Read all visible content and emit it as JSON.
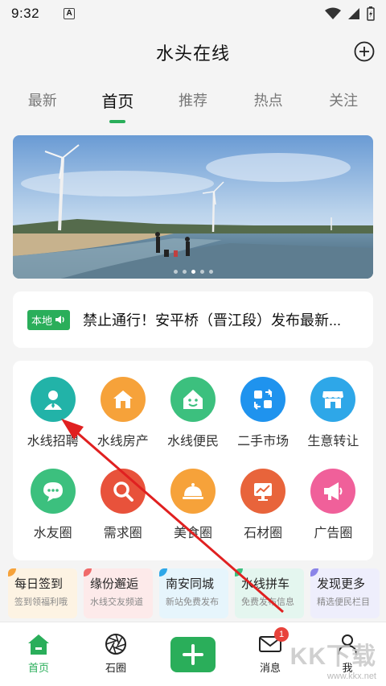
{
  "status": {
    "time": "9:32",
    "notification_badge": "A"
  },
  "app": {
    "title": "水头在线"
  },
  "tabs": [
    {
      "label": "最新"
    },
    {
      "label": "首页"
    },
    {
      "label": "推荐"
    },
    {
      "label": "热点"
    },
    {
      "label": "关注"
    }
  ],
  "active_tab": "首页",
  "banner": {
    "slides": 5,
    "active_slide": 3
  },
  "notice": {
    "badge": "本地",
    "text": "禁止通行！安平桥（晋江段）发布最新..."
  },
  "services": [
    {
      "label": "水线招聘",
      "icon": "person-icon",
      "color": "#22b3a8"
    },
    {
      "label": "水线房产",
      "icon": "house-icon",
      "color": "#f6a23a"
    },
    {
      "label": "水线便民",
      "icon": "smile-house-icon",
      "color": "#3cc07e"
    },
    {
      "label": "二手市场",
      "icon": "exchange-icon",
      "color": "#1f93ee"
    },
    {
      "label": "生意转让",
      "icon": "shop-icon",
      "color": "#2ea7e8"
    },
    {
      "label": "水友圈",
      "icon": "chat-icon",
      "color": "#3cc07e"
    },
    {
      "label": "需求圈",
      "icon": "magnifier-icon",
      "color": "#e8523b"
    },
    {
      "label": "美食圈",
      "icon": "food-cover-icon",
      "color": "#f6a23a"
    },
    {
      "label": "石材圈",
      "icon": "chart-icon",
      "color": "#e8643b"
    },
    {
      "label": "广告圈",
      "icon": "megaphone-icon",
      "color": "#f0609a"
    }
  ],
  "shortcuts": [
    {
      "title": "每日签到",
      "sub": "签到领福利哦",
      "bg": "#fdf3e3",
      "accent": "#f6a23a"
    },
    {
      "title": "缘份邂逅",
      "sub": "水线交友频道",
      "bg": "#fdeaea",
      "accent": "#f06a6a"
    },
    {
      "title": "南安同城",
      "sub": "新站免费发布",
      "bg": "#e6f5fc",
      "accent": "#2ea7e8"
    },
    {
      "title": "水线拼车",
      "sub": "免费发布信息",
      "bg": "#e4f6ef",
      "accent": "#3cc07e"
    },
    {
      "title": "发现更多",
      "sub": "精选便民栏目",
      "bg": "#eeeefc",
      "accent": "#8a84e8"
    }
  ],
  "bottom_nav": [
    {
      "label": "首页"
    },
    {
      "label": "石圈"
    },
    {
      "label": ""
    },
    {
      "label": "消息",
      "badge": "1"
    },
    {
      "label": "我"
    }
  ],
  "watermark": {
    "brand": "KK下载",
    "url": "www.kkx.net"
  },
  "colors": {
    "primary": "#2aae5a",
    "arrow": "#e02020"
  }
}
